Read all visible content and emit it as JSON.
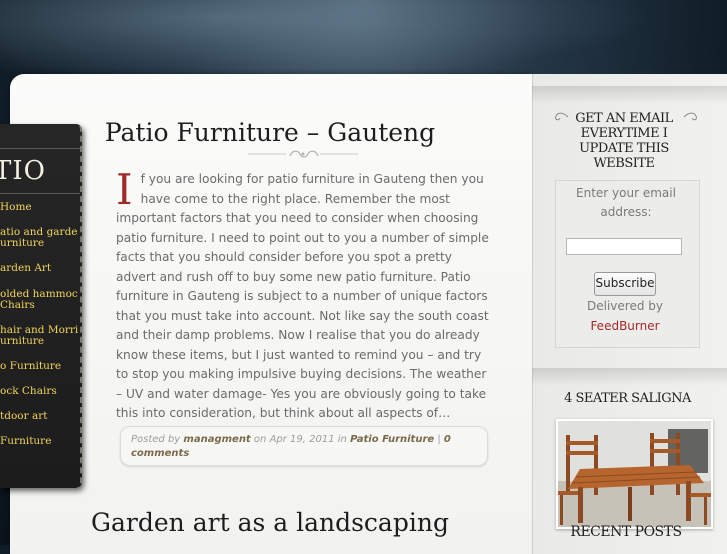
{
  "nav": {
    "title": "TIO",
    "items": [
      {
        "label": "Home"
      },
      {
        "label": "atio and garden"
      },
      {
        "label": "urniture"
      },
      {
        "label": "arden Art"
      },
      {
        "label": "olded hammock"
      },
      {
        "label": "Chairs"
      },
      {
        "label": "hair and Morris"
      },
      {
        "label": "urniture"
      },
      {
        "label": "o Furniture"
      },
      {
        "label": "ock Chairs"
      },
      {
        "label": "tdoor art"
      },
      {
        "label": "Furniture"
      }
    ]
  },
  "post1": {
    "title": "Patio Furniture – Gauteng",
    "dropcap": "I",
    "body": "f you are looking for patio furniture in Gauteng then you have come to the right place. Remember the most important factors that you need to consider when choosing patio furniture. I need to point out to you a number of simple facts that you should consider before you spot a pretty advert and rush off to buy some new patio furniture. Patio furniture in Gauteng is subject to a number of unique factors that you must take into account. Not like say the south coast and their damp problems. Now I realise that you do already know these items, but I just wanted to remind you – and try to stop you making impulsive buying decisions. The weather – UV and water damage- Yes you are obviously going to take this into consideration, but think about all aspects of…",
    "meta": {
      "posted_by": "Posted by",
      "author": "managment",
      "on": "on",
      "date": "Apr 19, 2011",
      "in": "in",
      "category": "Patio Furniture",
      "sep": "|",
      "comments": "0 comments"
    }
  },
  "post2": {
    "title": "Garden art as a landscaping"
  },
  "sidebar": {
    "email_title": "GET AN EMAIL EVERYTIME I UPDATE THIS WEBSITE",
    "email_label": "Enter your email address:",
    "subscribe_label": "Subscribe",
    "delivered_by": "Delivered by",
    "feedburner": "FeedBurner",
    "saligna_title": "4 SEATER SALIGNA",
    "recent_title": "RECENT POSTS"
  }
}
